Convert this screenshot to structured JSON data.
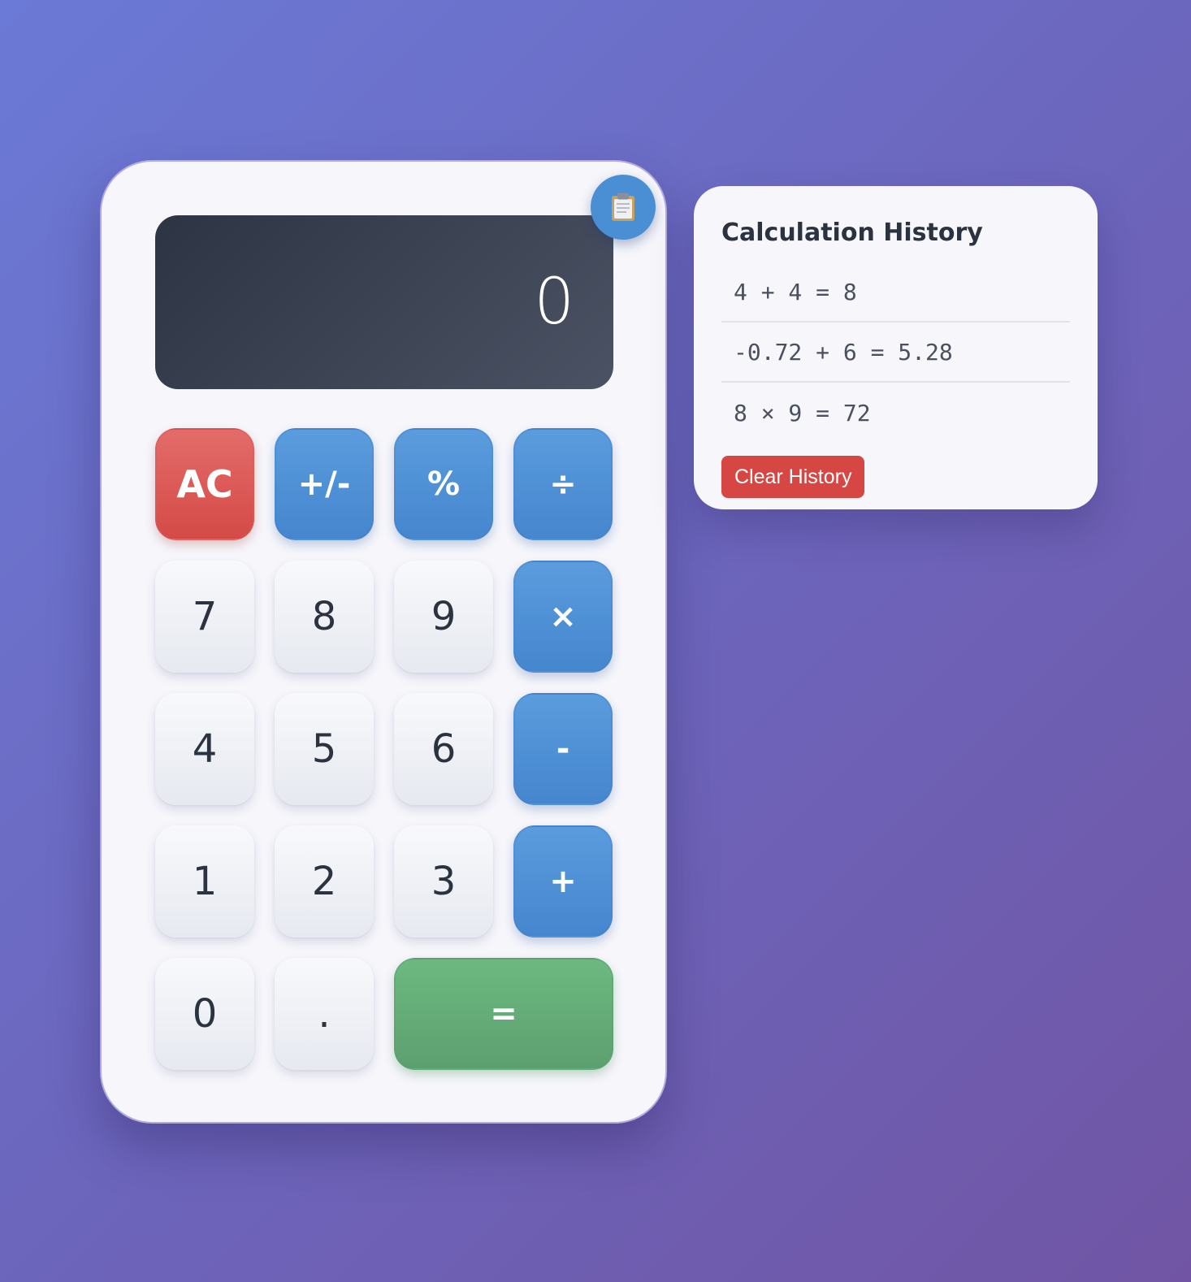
{
  "display": {
    "value": "0"
  },
  "history_toggle": {
    "icon": "clipboard-icon",
    "glyph": "📋"
  },
  "keypad": {
    "row1": {
      "clear": "AC",
      "sign": "+/-",
      "percent": "%",
      "divide": "÷"
    },
    "row2": {
      "seven": "7",
      "eight": "8",
      "nine": "9",
      "multiply": "×"
    },
    "row3": {
      "four": "4",
      "five": "5",
      "six": "6",
      "subtract": "-"
    },
    "row4": {
      "one": "1",
      "two": "2",
      "three": "3",
      "add": "+"
    },
    "row5": {
      "zero": "0",
      "decimal": ".",
      "equals": "="
    }
  },
  "history": {
    "title": "Calculation History",
    "items": [
      "4 + 4 = 8",
      "-0.72 + 6 = 5.28",
      "8 × 9 = 72"
    ],
    "clear_label": "Clear History"
  },
  "colors": {
    "operator": "#4a8fd4",
    "clear": "#d64743",
    "equals": "#62ad77",
    "display": "#3a4150"
  }
}
